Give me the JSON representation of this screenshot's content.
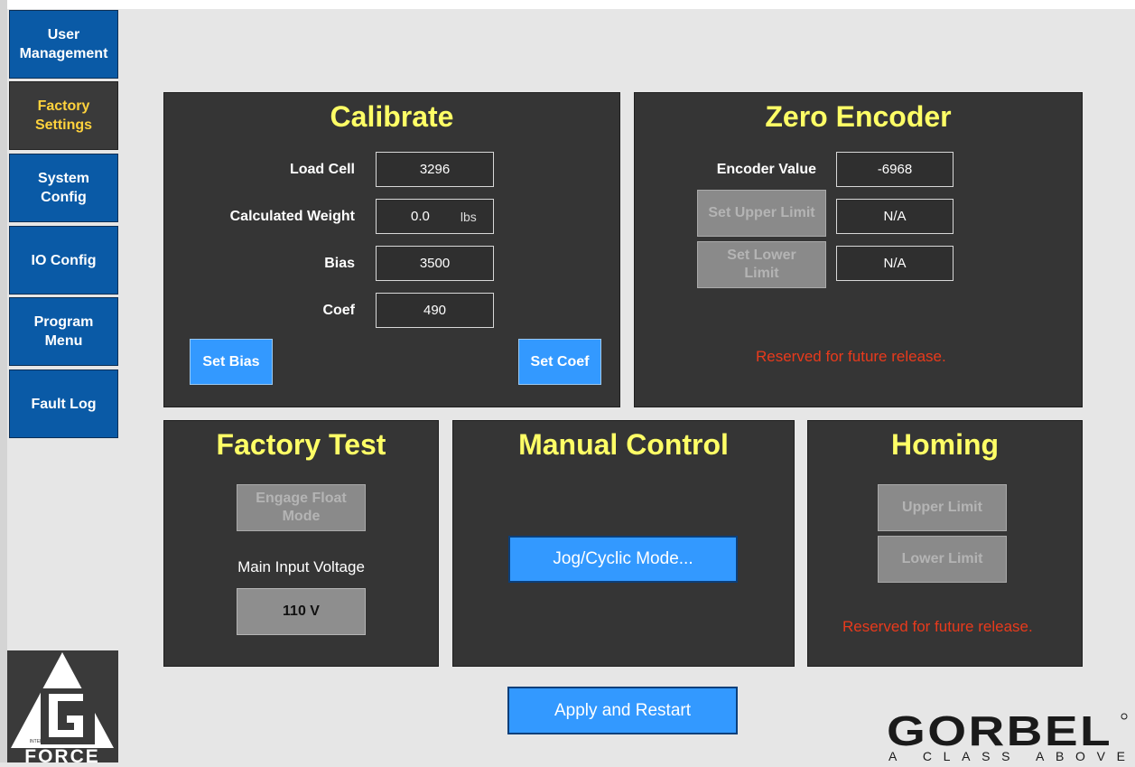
{
  "nav": {
    "items": [
      {
        "label": "User\nManagement"
      },
      {
        "label": "Factory\nSettings",
        "active": true
      },
      {
        "label": "System\nConfig"
      },
      {
        "label": "IO Config"
      },
      {
        "label": "Program\nMenu"
      },
      {
        "label": "Fault Log"
      }
    ]
  },
  "calibrate": {
    "title": "Calibrate",
    "load_cell_label": "Load Cell",
    "load_cell_value": "3296",
    "calc_weight_label": "Calculated Weight",
    "calc_weight_value": "0.0",
    "calc_weight_unit": "lbs",
    "bias_label": "Bias",
    "bias_value": "3500",
    "coef_label": "Coef",
    "coef_value": "490",
    "set_bias_button": "Set Bias",
    "set_coef_button": "Set Coef"
  },
  "zero_encoder": {
    "title": "Zero Encoder",
    "encoder_label": "Encoder Value",
    "encoder_value": "-6968",
    "set_upper_button": "Set Upper Limit",
    "upper_value": "N/A",
    "set_lower_button": "Set Lower\nLimit",
    "lower_value": "N/A",
    "reserved_text": "Reserved for future release."
  },
  "factory_test": {
    "title": "Factory Test",
    "engage_button": "Engage Float\nMode",
    "voltage_label": "Main Input Voltage",
    "voltage_value": "110 V"
  },
  "manual_control": {
    "title": "Manual Control",
    "jog_button": "Jog/Cyclic Mode..."
  },
  "homing": {
    "title": "Homing",
    "upper_button": "Upper Limit",
    "lower_button": "Lower Limit",
    "reserved_text": "Reserved for future release."
  },
  "apply_button": "Apply and Restart",
  "logos": {
    "gforce_text": "FORCE",
    "gforce_tagline": "INTELLIGENT LIFTING DEVICE",
    "gorbel_text": "GORBEL",
    "gorbel_tagline": "A CLASS ABOVE"
  },
  "colors": {
    "nav_blue": "#0a5aa6",
    "panel_dark": "#353535",
    "title_yellow": "#ffff66",
    "button_blue": "#3399ff",
    "reserved_red": "#e83a1c"
  }
}
